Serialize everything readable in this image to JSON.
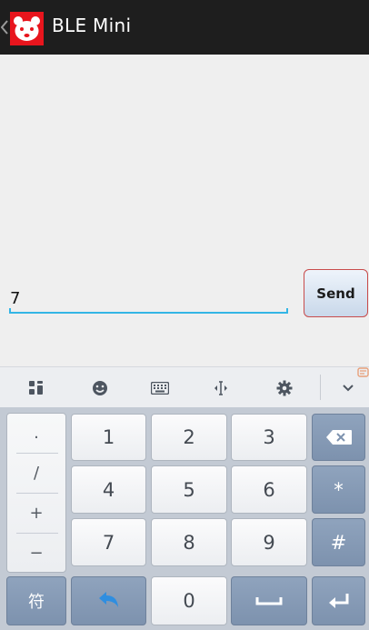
{
  "app": {
    "title": "BLE Mini"
  },
  "input": {
    "value": "7"
  },
  "send_button": {
    "label": "Send"
  },
  "keyboard": {
    "toolbar": [
      "layout",
      "emoji",
      "keyboard",
      "cursor",
      "settings",
      "collapse"
    ],
    "symbols": [
      ".",
      "/",
      "+",
      "−"
    ],
    "digits_row1": [
      "1",
      "2",
      "3"
    ],
    "digits_row2": [
      "4",
      "5",
      "6"
    ],
    "digits_row3": [
      "7",
      "8",
      "9"
    ],
    "right_keys": [
      "⌫",
      "*",
      "#"
    ],
    "bottom": {
      "symbol_toggle": "符",
      "zero": "0"
    }
  },
  "colors": {
    "action_bar": "#1e1e1e",
    "app_logo": "#e8151d",
    "input_accent": "#33b5e5",
    "send_border": "#c84c4c",
    "dark_key": "#8598b3"
  }
}
